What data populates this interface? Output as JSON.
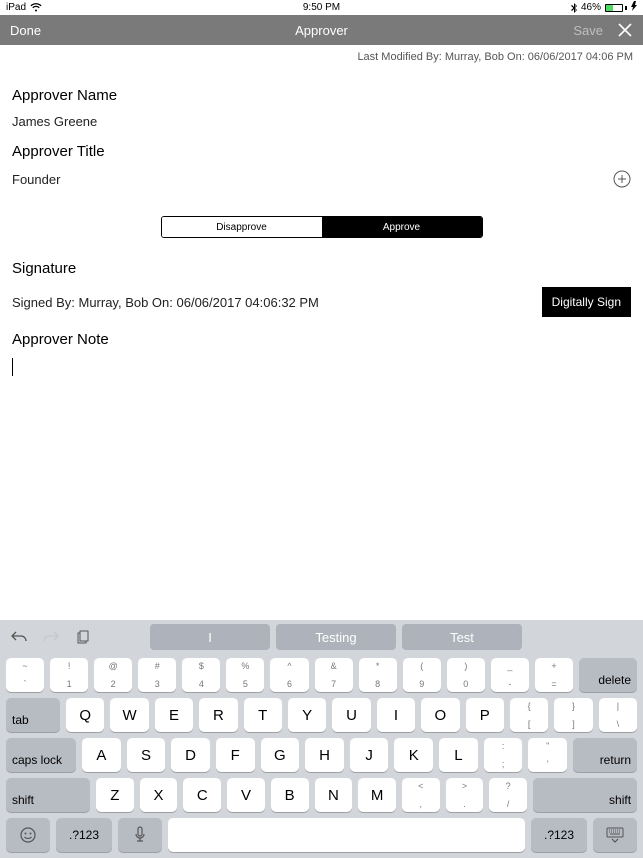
{
  "status": {
    "device": "iPad",
    "time": "9:50 PM",
    "battery_pct": "46%"
  },
  "nav": {
    "done": "Done",
    "title": "Approver",
    "save": "Save"
  },
  "last_modified": "Last Modified By: Murray, Bob On: 06/06/2017 04:06 PM",
  "fields": {
    "name_label": "Approver Name",
    "name_value": "James Greene",
    "title_label": "Approver Title",
    "title_value": "Founder",
    "signature_label": "Signature",
    "signature_value": "Signed By: Murray, Bob On: 06/06/2017 04:06:32 PM",
    "note_label": "Approver Note",
    "note_value": ""
  },
  "seg": {
    "disapprove": "Disapprove",
    "approve": "Approve"
  },
  "buttons": {
    "digitally_sign": "Digitally Sign"
  },
  "keyboard": {
    "suggestions": [
      "I",
      "Testing",
      "Test"
    ],
    "row0": [
      {
        "t": "~",
        "b": "`"
      },
      {
        "t": "!",
        "b": "1"
      },
      {
        "t": "@",
        "b": "2"
      },
      {
        "t": "#",
        "b": "3"
      },
      {
        "t": "$",
        "b": "4"
      },
      {
        "t": "%",
        "b": "5"
      },
      {
        "t": "^",
        "b": "6"
      },
      {
        "t": "&",
        "b": "7"
      },
      {
        "t": "*",
        "b": "8"
      },
      {
        "t": "(",
        "b": "9"
      },
      {
        "t": ")",
        "b": "0"
      },
      {
        "t": "_",
        "b": "-"
      },
      {
        "t": "+",
        "b": "="
      }
    ],
    "fn": {
      "delete": "delete",
      "tab": "tab",
      "caps": "caps lock",
      "return": "return",
      "shift": "shift",
      "numbers": ".?123"
    },
    "row1": [
      "Q",
      "W",
      "E",
      "R",
      "T",
      "Y",
      "U",
      "I",
      "O",
      "P"
    ],
    "row1_tail": [
      {
        "t": "{",
        "b": "["
      },
      {
        "t": "}",
        "b": "]"
      },
      {
        "t": "|",
        "b": "\\"
      }
    ],
    "row2": [
      "A",
      "S",
      "D",
      "F",
      "G",
      "H",
      "J",
      "K",
      "L"
    ],
    "row2_tail": [
      {
        "t": ":",
        "b": ";"
      },
      {
        "t": "\"",
        "b": "'"
      }
    ],
    "row3": [
      "Z",
      "X",
      "C",
      "V",
      "B",
      "N",
      "M"
    ],
    "row3_tail": [
      {
        "t": "<",
        "b": ","
      },
      {
        "t": ">",
        "b": "."
      },
      {
        "t": "?",
        "b": "/"
      }
    ]
  }
}
